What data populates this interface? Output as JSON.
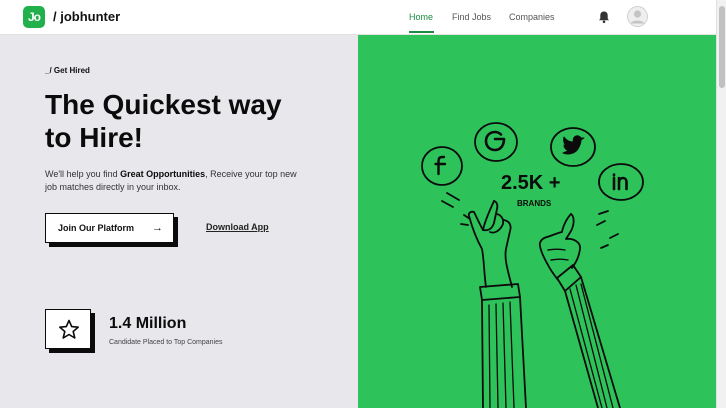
{
  "header": {
    "logo_text": "Jo",
    "brand": "/ jobhunter",
    "nav": [
      {
        "label": "Home",
        "active": true
      },
      {
        "label": "Find Jobs",
        "active": false
      },
      {
        "label": "Companies",
        "active": false
      }
    ],
    "icons": [
      "bell-icon",
      "avatar-icon"
    ]
  },
  "hero": {
    "eyebrow": "_/ Get Hired",
    "headline_line1": "The Quickest way",
    "headline_line2": "to Hire!",
    "subtext_pre": "We'll help you find ",
    "subtext_bold": "Great Opportunities",
    "subtext_post": ", Receive your top new job matches directly in your inbox.",
    "cta_primary": "Join Our Platform",
    "cta_arrow": "→",
    "cta_secondary": "Download App",
    "stat_value": "1.4 Million",
    "stat_label": "Candidate Placed to Top Companies",
    "stat_icon": "star-icon"
  },
  "illustration": {
    "count": "2.5K +",
    "label": "BRANDS",
    "social_icons": [
      "facebook-icon",
      "google-icon",
      "twitter-icon",
      "linkedin-icon"
    ],
    "background": "#2ec25a"
  },
  "colors": {
    "accent": "#1c8c44",
    "logo": "#21b04b",
    "hero_bg": "#e8e8ec"
  }
}
